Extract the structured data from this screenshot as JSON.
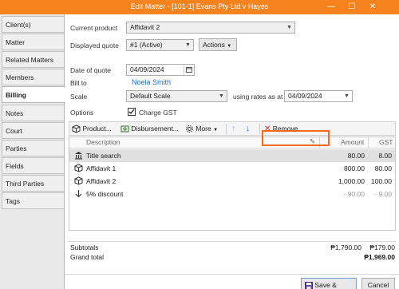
{
  "window": {
    "title": "Edit Matter - [101-1] Evans Pty Ltd v Hayes",
    "minimize_glyph": "—",
    "maximize_glyph": "☐",
    "close_glyph": "✕"
  },
  "tabs": [
    {
      "label": "Client(s)"
    },
    {
      "label": "Matter"
    },
    {
      "label": "Related Matters"
    },
    {
      "label": "Members"
    },
    {
      "label": "Billing"
    },
    {
      "label": "Notes"
    },
    {
      "label": "Court"
    },
    {
      "label": "Parties"
    },
    {
      "label": "Fields"
    },
    {
      "label": "Third Parties"
    },
    {
      "label": "Tags"
    }
  ],
  "active_tab": "Billing",
  "form": {
    "current_product_label": "Current product",
    "current_product_value": "Affidavit 2",
    "displayed_quote_label": "Displayed quote",
    "displayed_quote_value": "#1 (Active)",
    "actions_label": "Actions",
    "date_of_quote_label": "Date of quote",
    "date_of_quote_value": "04/09/2024",
    "bill_to_label": "Bill to",
    "bill_to_value": "Noela Smith",
    "scale_label": "Scale",
    "scale_value": "Default Scale",
    "rates_label": "using rates as at",
    "rates_date": "04/09/2024",
    "options_label": "Options",
    "charge_gst_label": "Charge GST",
    "charge_gst_checked": true
  },
  "toolbar": {
    "product_label": "Product...",
    "disbursement_label": "Disbursement...",
    "more_label": "More",
    "remove_label": "Remove"
  },
  "grid": {
    "columns": {
      "description": "Description",
      "amount": "Amount",
      "gst": "GST"
    },
    "rows": [
      {
        "icon": "bank-icon",
        "description": "Title search",
        "amount": "80.00",
        "gst": "8.00",
        "selected": true
      },
      {
        "icon": "product-box-icon",
        "description": "Affidavit 1",
        "amount": "800.00",
        "gst": "80.00"
      },
      {
        "icon": "product-box-icon",
        "description": "Affidavit 2",
        "amount": "1,000.00",
        "gst": "100.00"
      },
      {
        "icon": "down-arrow-icon",
        "description": "5% discount",
        "amount": "- 90.00",
        "gst": "- 9.00",
        "muted": true
      }
    ]
  },
  "totals": {
    "subtotals_label": "Subtotals",
    "subtotals_amount": "₱1,790.00",
    "subtotals_gst": "₱179.00",
    "grand_total_label": "Grand total",
    "grand_total_value": "₱1,969.00"
  },
  "footer": {
    "save_close_label": "Save & Close",
    "cancel_label": "Cancel"
  },
  "colors": {
    "title_bar": "#f6831e",
    "highlight_box": "#f26b1d",
    "link": "#1a6fd0"
  }
}
